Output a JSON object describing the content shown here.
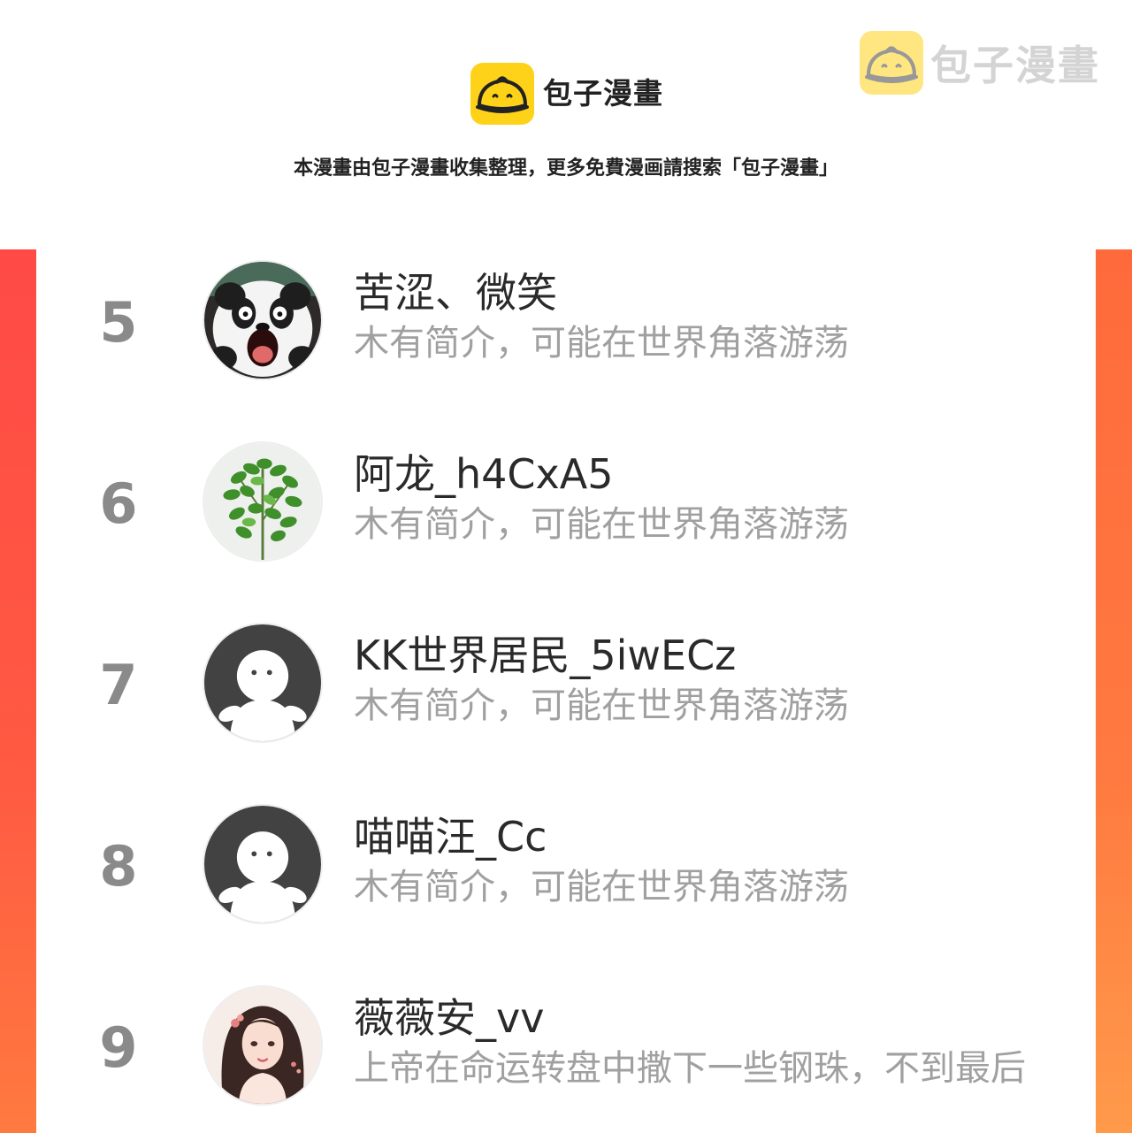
{
  "header": {
    "brand_name": "包子漫畫",
    "notice": "本漫畫由包子漫畫收集整理，更多免費漫画請搜索「包子漫畫」",
    "watermark_text": "包子漫畫"
  },
  "colors": {
    "accent_left": "#ff4a46",
    "accent_right": "#ff7a40",
    "logo_yellow": "#ffd21a"
  },
  "ranking": [
    {
      "rank": "5",
      "name": "苦涩、微笑",
      "bio": "木有简介，可能在世界角落游荡",
      "avatar": "panda-avatar"
    },
    {
      "rank": "6",
      "name": "阿龙_h4CxA5",
      "bio": "木有简介，可能在世界角落游荡",
      "avatar": "plant-avatar"
    },
    {
      "rank": "7",
      "name": "KK世界居民_5iwECz",
      "bio": "木有简介，可能在世界角落游荡",
      "avatar": "default-avatar"
    },
    {
      "rank": "8",
      "name": "喵喵汪_Cc",
      "bio": "木有简介，可能在世界角落游荡",
      "avatar": "default-avatar"
    },
    {
      "rank": "9",
      "name": "薇薇安_vv",
      "bio": "上帝在命运转盘中撒下一些钢珠，不到最后",
      "avatar": "girl-avatar"
    }
  ]
}
